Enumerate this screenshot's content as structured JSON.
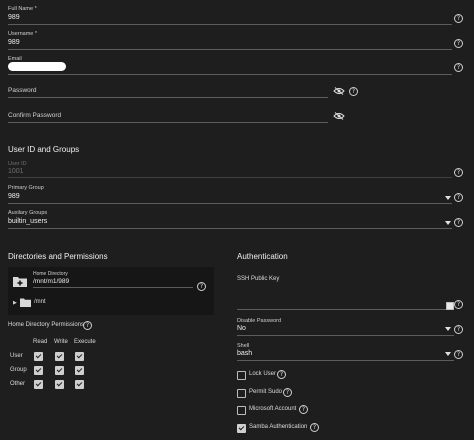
{
  "fields": {
    "full_name": {
      "label": "Full Name *",
      "value": "989"
    },
    "username": {
      "label": "Username *",
      "value": "989"
    },
    "email": {
      "label": "Email"
    },
    "password": {
      "placeholder": "Password"
    },
    "confirm_password": {
      "placeholder": "Confirm Password"
    }
  },
  "user_groups": {
    "title": "User ID and Groups",
    "user_id": {
      "label": "User ID",
      "value": "1001"
    },
    "primary_group": {
      "label": "Primary Group",
      "value": "989"
    },
    "aux_groups": {
      "label": "Auxilary Groups",
      "value": "builtin_users"
    }
  },
  "directories": {
    "title": "Directories and Permissions",
    "home_dir": {
      "label": "Home Directory",
      "value": "/mnt/m1/989"
    },
    "tree_item": "/mnt",
    "perm_title": "Home Directory Permissions",
    "columns": [
      "Read",
      "Write",
      "Execute"
    ],
    "rows": [
      "User",
      "Group",
      "Other"
    ]
  },
  "auth": {
    "title": "Authentication",
    "ssh_key_label": "SSH Public Key",
    "disable_password": {
      "label": "Disable Password",
      "value": "No"
    },
    "shell": {
      "label": "Shell",
      "value": "bash"
    },
    "options": [
      {
        "label": "Lock User",
        "checked": false
      },
      {
        "label": "Permit Sudo",
        "checked": false
      },
      {
        "label": "Microsoft Account",
        "checked": false
      },
      {
        "label": "Samba Authentication",
        "checked": true
      }
    ]
  },
  "colors": {
    "background": "#1e1e1e",
    "text": "#e6e6e6",
    "divider": "#5c5c5c"
  }
}
